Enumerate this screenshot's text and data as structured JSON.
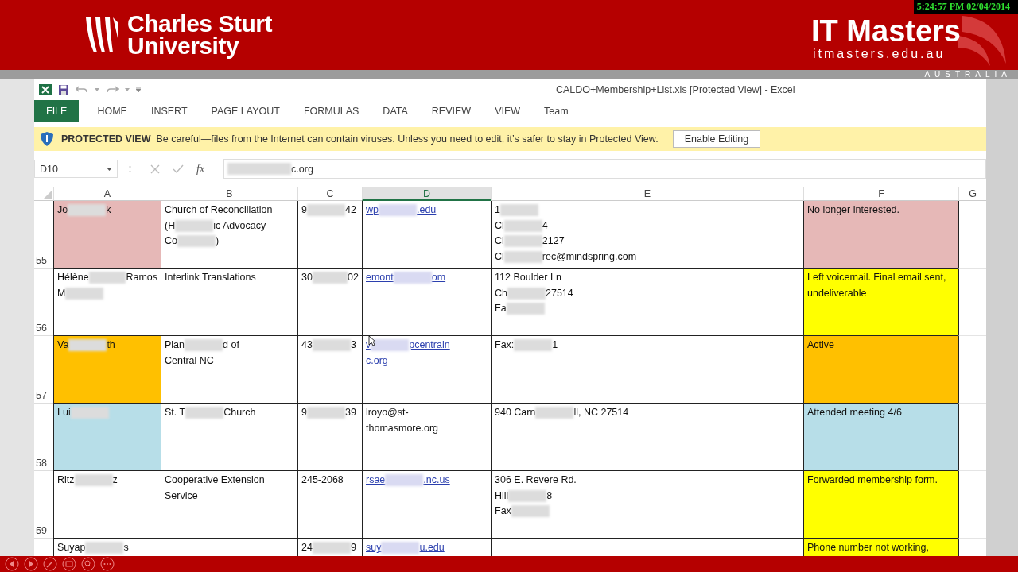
{
  "banner": {
    "university": [
      "Charles Sturt",
      "University"
    ],
    "brand": "IT Masters",
    "brand_url": "itmasters.edu.au",
    "country": "AUSTRALIA",
    "timestamp": "5:24:57 PM 02/04/2014"
  },
  "window": {
    "title": "CALDO+Membership+List.xls  [Protected View] - Excel"
  },
  "tabs": [
    {
      "label": "FILE",
      "kind": "file"
    },
    {
      "label": "HOME",
      "kind": "tab"
    },
    {
      "label": "INSERT",
      "kind": "tab"
    },
    {
      "label": "PAGE LAYOUT",
      "kind": "tab"
    },
    {
      "label": "FORMULAS",
      "kind": "tab"
    },
    {
      "label": "DATA",
      "kind": "tab"
    },
    {
      "label": "REVIEW",
      "kind": "tab"
    },
    {
      "label": "VIEW",
      "kind": "tab"
    },
    {
      "label": "Team",
      "kind": "tab"
    }
  ],
  "protected_bar": {
    "title": "PROTECTED VIEW",
    "message": "Be careful—files from the Internet can contain viruses. Unless you need to edit, it’s safer to stay in Protected View.",
    "button": "Enable Editing"
  },
  "formula_bar": {
    "name_box": "D10",
    "fx": "fx",
    "value": {
      "parts": [
        "c.org"
      ],
      "lead_blur": true
    }
  },
  "columns": [
    {
      "label": "A",
      "selected": false
    },
    {
      "label": "B",
      "selected": false
    },
    {
      "label": "C",
      "selected": false
    },
    {
      "label": "D",
      "selected": true
    },
    {
      "label": "E",
      "selected": false
    },
    {
      "label": "F",
      "selected": false
    },
    {
      "label": "G",
      "selected": false
    }
  ],
  "rows": [
    {
      "number": "55",
      "cells": [
        {
          "kind": "text",
          "color": "#e6b8b7",
          "lines": [
            {
              "parts": [
                "Jo",
                "k"
              ]
            }
          ]
        },
        {
          "kind": "text",
          "lines": [
            {
              "parts": [
                "Church of Reconciliation"
              ]
            },
            {
              "parts": [
                "(H",
                "ic Advocacy"
              ]
            },
            {
              "parts": [
                "Co",
                ")"
              ]
            }
          ]
        },
        {
          "kind": "text",
          "lines": [
            {
              "parts": [
                "9",
                "42"
              ]
            }
          ]
        },
        {
          "kind": "link",
          "lines": [
            {
              "parts": [
                "wp",
                ".edu"
              ]
            }
          ]
        },
        {
          "kind": "text",
          "lines": [
            {
              "parts": [
                "1"
              ],
              "trail_blur": true
            },
            {
              "parts": [
                "Cl",
                "4"
              ]
            },
            {
              "parts": [
                "Cl",
                "2127"
              ]
            },
            {
              "parts": [
                "Cl",
                "rec@mindspring.com"
              ]
            }
          ]
        },
        {
          "kind": "text",
          "color": "#e6b8b7",
          "lines": [
            {
              "parts": [
                "No longer interested."
              ]
            }
          ]
        }
      ]
    },
    {
      "number": "56",
      "cells": [
        {
          "kind": "text",
          "lines": [
            {
              "parts": [
                "Hélène",
                "Ramos"
              ]
            },
            {
              "parts": [
                "M"
              ],
              "trail_blur": true
            }
          ]
        },
        {
          "kind": "text",
          "lines": [
            {
              "parts": [
                "Interlink Translations"
              ]
            }
          ]
        },
        {
          "kind": "text",
          "lines": [
            {
              "parts": [
                "30",
                "02"
              ]
            }
          ]
        },
        {
          "kind": "link",
          "lines": [
            {
              "parts": [
                "emont",
                "om"
              ]
            }
          ]
        },
        {
          "kind": "text",
          "lines": [
            {
              "parts": [
                "112 Boulder Ln"
              ]
            },
            {
              "parts": [
                "Ch",
                "27514"
              ]
            },
            {
              "parts": [
                "Fa"
              ],
              "trail_blur": true
            }
          ]
        },
        {
          "kind": "text",
          "color": "#ffff00",
          "lines": [
            {
              "parts": [
                "Left voicemail. Final email sent,"
              ]
            },
            {
              "parts": [
                "undeliverable"
              ]
            }
          ]
        }
      ]
    },
    {
      "number": "57",
      "cells": [
        {
          "kind": "text",
          "color": "#ffc000",
          "lines": [
            {
              "parts": [
                "Va",
                "th"
              ]
            }
          ]
        },
        {
          "kind": "text",
          "lines": [
            {
              "parts": [
                "Plan",
                "d of"
              ]
            },
            {
              "parts": [
                "Central NC"
              ]
            }
          ]
        },
        {
          "kind": "text",
          "lines": [
            {
              "parts": [
                "43",
                "3"
              ]
            }
          ]
        },
        {
          "kind": "link",
          "lines": [
            {
              "parts": [
                "v",
                "pcentraln"
              ]
            },
            {
              "parts": [
                "c.org"
              ]
            }
          ]
        },
        {
          "kind": "text",
          "lines": [
            {
              "parts": [
                "Fax:",
                "1"
              ]
            }
          ]
        },
        {
          "kind": "text",
          "color": "#ffc000",
          "lines": [
            {
              "parts": [
                "Active"
              ]
            }
          ]
        }
      ]
    },
    {
      "number": "58",
      "cells": [
        {
          "kind": "text",
          "color": "#b7dee8",
          "lines": [
            {
              "parts": [
                "Lui"
              ],
              "trail_blur": true
            }
          ]
        },
        {
          "kind": "text",
          "lines": [
            {
              "parts": [
                "St. T",
                "Church"
              ]
            }
          ]
        },
        {
          "kind": "text",
          "lines": [
            {
              "parts": [
                "9",
                "39"
              ]
            }
          ]
        },
        {
          "kind": "text",
          "lines": [
            {
              "parts": [
                "lroyo@st-"
              ]
            },
            {
              "parts": [
                "thomasmore.org"
              ]
            }
          ]
        },
        {
          "kind": "text",
          "lines": [
            {
              "parts": [
                "940 Carn",
                "ll, NC 27514"
              ]
            }
          ]
        },
        {
          "kind": "text",
          "color": "#b7dee8",
          "lines": [
            {
              "parts": [
                "Attended meeting 4/6"
              ]
            }
          ]
        }
      ]
    },
    {
      "number": "59",
      "cells": [
        {
          "kind": "text",
          "lines": [
            {
              "parts": [
                "Ritz",
                "z"
              ]
            }
          ]
        },
        {
          "kind": "text",
          "lines": [
            {
              "parts": [
                "Cooperative Extension"
              ]
            },
            {
              "parts": [
                "Service"
              ]
            }
          ]
        },
        {
          "kind": "text",
          "lines": [
            {
              "parts": [
                "245-2068"
              ]
            }
          ]
        },
        {
          "kind": "link",
          "lines": [
            {
              "parts": [
                "rsae",
                ".nc.us"
              ]
            }
          ]
        },
        {
          "kind": "text",
          "lines": [
            {
              "parts": [
                "306 E. Revere Rd."
              ]
            },
            {
              "parts": [
                "Hill",
                "8"
              ]
            },
            {
              "parts": [
                "Fax"
              ],
              "trail_blur": true
            }
          ]
        },
        {
          "kind": "text",
          "color": "#ffff00",
          "lines": [
            {
              "parts": [
                "Forwarded membership form."
              ]
            }
          ]
        }
      ]
    },
    {
      "cells": [
        {
          "kind": "text",
          "lines": [
            {
              "parts": [
                "Suyap",
                "s"
              ]
            }
          ]
        },
        {
          "kind": "text"
        },
        {
          "kind": "text",
          "lines": [
            {
              "parts": [
                "24",
                "9"
              ]
            }
          ]
        },
        {
          "kind": "link",
          "lines": [
            {
              "parts": [
                "suy",
                "u.edu"
              ]
            }
          ]
        },
        {
          "kind": "text"
        },
        {
          "kind": "text",
          "color": "#ffff00",
          "lines": [
            {
              "parts": [
                "Phone number not working,"
              ]
            }
          ]
        }
      ]
    }
  ]
}
